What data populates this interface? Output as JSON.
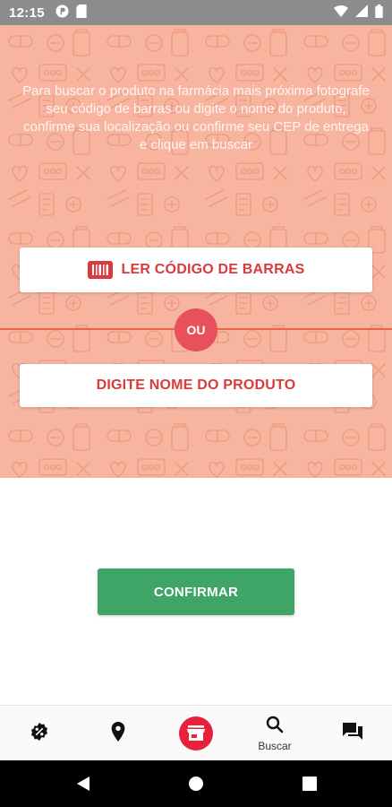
{
  "status_bar": {
    "time": "12:15",
    "left_icons": [
      "circle-badge-icon",
      "sd-card-icon"
    ],
    "right_icons": [
      "wifi-icon",
      "cellular-icon",
      "battery-icon"
    ]
  },
  "search": {
    "instruction": "Para buscar o produto na farmácia mais próxima fotografe seu código de barras ou digite o nome do produto, confirme sua localização ou confirme seu CEP de entrega e clique em buscar",
    "barcode_button_label": "LER CÓDIGO DE BARRAS",
    "divider_label": "OU",
    "product_button_label": "DIGITE NOME DO PRODUTO"
  },
  "confirm_button_label": "CONFIRMAR",
  "bottom_nav": {
    "items": [
      {
        "icon": "discount-badge-icon",
        "label": ""
      },
      {
        "icon": "location-pin-icon",
        "label": ""
      },
      {
        "icon": "store-icon",
        "label": ""
      },
      {
        "icon": "search-icon",
        "label": "Buscar"
      },
      {
        "icon": "chat-icon",
        "label": ""
      }
    ]
  },
  "colors": {
    "hero_background": "#f7b5a0",
    "accent_red": "#d93a3a",
    "badge_red": "#e8505b",
    "confirm_green": "#3ea567",
    "status_bar": "#8c8c8c"
  }
}
